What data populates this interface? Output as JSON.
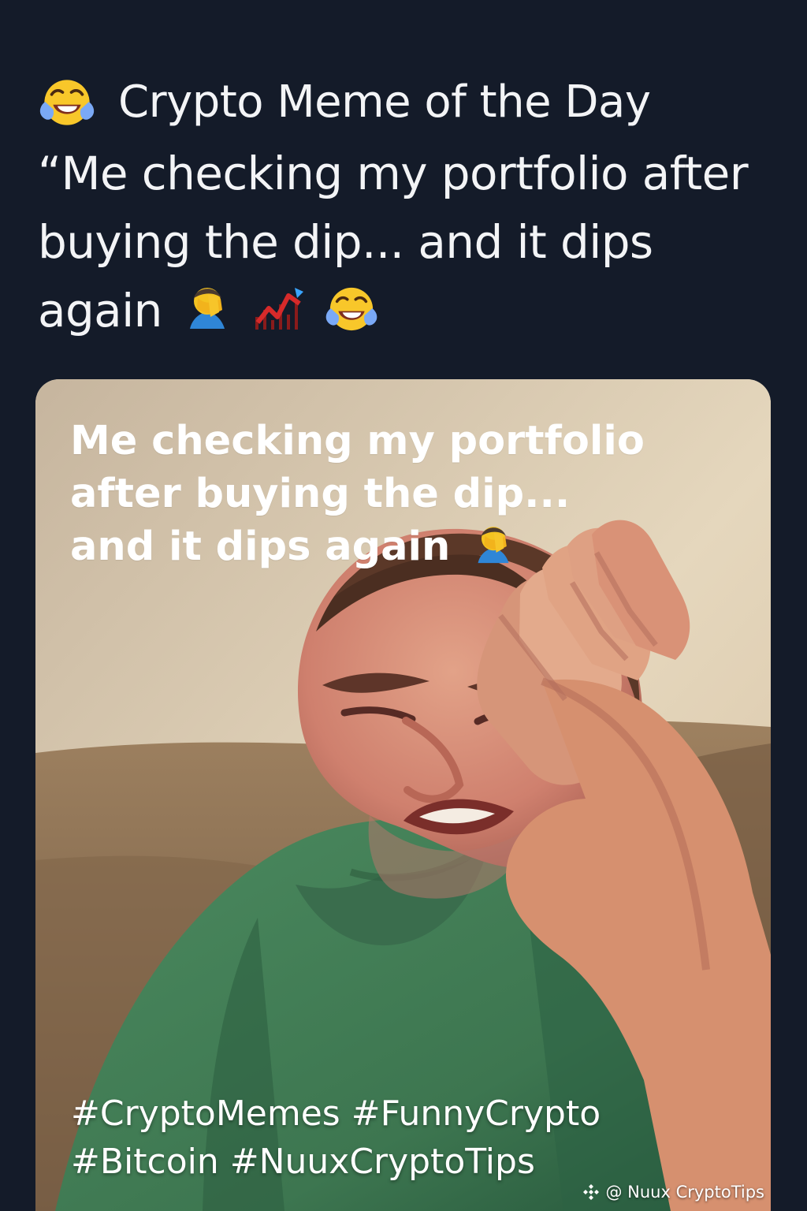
{
  "post": {
    "title": "Crypto Meme of the Day",
    "title_icon": "laughing-tears-emoji-icon",
    "body_text": "“Me checking my portfolio after buying the dip... and it dips again",
    "body_icons": [
      "facepalm-person-icon",
      "chart-dip-icon",
      "laughing-tears-emoji-icon"
    ]
  },
  "meme": {
    "caption_lines": [
      "Me checking my portfolio",
      "after buying the dip...",
      "and it dips again"
    ],
    "caption_icon": "facepalm-person-icon",
    "hashtags": [
      "#CryptoMemes #FunnyCrypto",
      "#Bitcoin #NuuxCryptoTips"
    ],
    "watermark": "@ Nuux CryptoTips",
    "watermark_icon": "binance-logo-icon"
  },
  "colors": {
    "page_background": "#141b29",
    "title_text": "#f3f4f6",
    "meme_text": "#ffffff",
    "shirt_green": "#3f7650",
    "couch_tan": "#8a6d52"
  }
}
